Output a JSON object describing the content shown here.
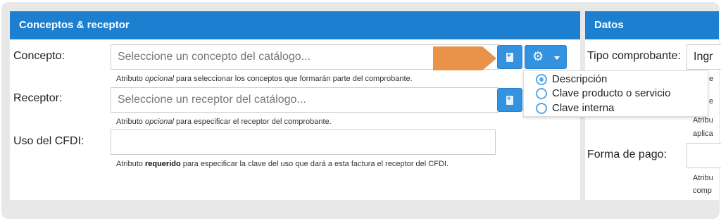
{
  "left_panel": {
    "title": "Conceptos & receptor",
    "concepto": {
      "label": "Concepto:",
      "placeholder": "Seleccione un concepto del catálogo...",
      "help_prefix": "Atributo ",
      "help_emph": "opcional",
      "help_suffix": " para seleccionar los conceptos que formarán parte del comprobante."
    },
    "receptor": {
      "label": "Receptor:",
      "placeholder": "Seleccione un receptor del catálogo...",
      "help_prefix": "Atributo ",
      "help_emph": "opcional",
      "help_suffix": " para especificar el receptor del comprobante."
    },
    "uso_cfdi": {
      "label": "Uso del CFDI:",
      "value": "",
      "help_prefix": "Atributo ",
      "help_strong": "requerido",
      "help_suffix": " para especificar la clave del uso que dará a esta factura el receptor del CFDI."
    }
  },
  "search_menu": {
    "options": [
      {
        "label": "Descripción",
        "selected": true
      },
      {
        "label": "Clave producto o servicio",
        "selected": false
      },
      {
        "label": "Clave interna",
        "selected": false
      }
    ]
  },
  "right_panel": {
    "title": "Datos",
    "tipo_comprobante": {
      "label": "Tipo comprobante:",
      "value": "Ingr"
    },
    "partial_help_1": "e",
    "partial_help_2": "e",
    "partial_help_3a": "Atribu",
    "partial_help_3b": "aplica",
    "forma_pago": {
      "label": "Forma de pago:",
      "value": ""
    },
    "partial_help_4a": "Atribu",
    "partial_help_4b": "comp"
  },
  "colors": {
    "header_blue": "#1d7fd0",
    "button_blue": "#3393e0",
    "arrow_orange": "#e8924a",
    "radio_blue": "#5aa7e3"
  },
  "icons": [
    "add-document-icon",
    "gear-icon",
    "caret-down-icon",
    "radio-icon"
  ]
}
